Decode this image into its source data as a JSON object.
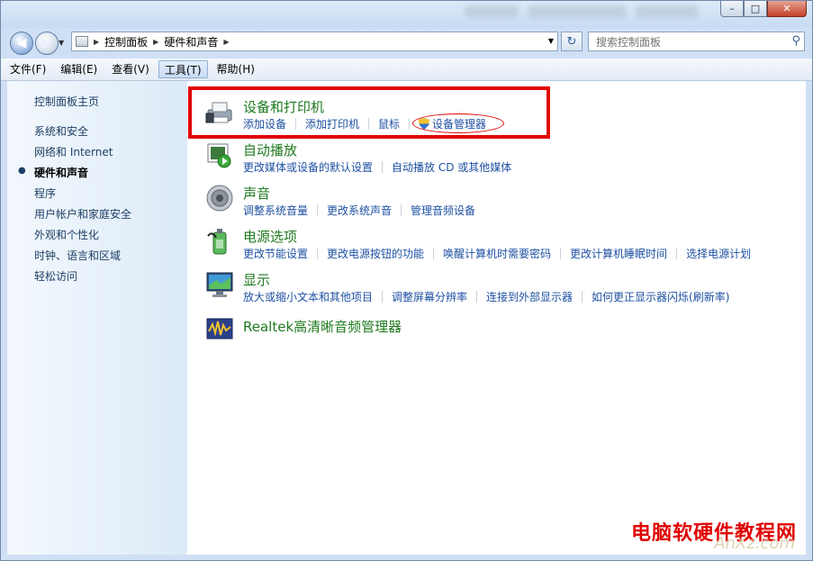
{
  "window": {
    "controls": {
      "minimize": "–",
      "maximize": "□",
      "close": "✕"
    }
  },
  "nav": {
    "back_icon": "back-arrow-icon",
    "forward_icon": "forward-arrow-icon",
    "breadcrumb": [
      "控制面板",
      "硬件和声音"
    ],
    "search_placeholder": "搜索控制面板"
  },
  "menu": {
    "items": [
      "文件(F)",
      "编辑(E)",
      "查看(V)",
      "工具(T)",
      "帮助(H)"
    ],
    "active_index": 3
  },
  "sidebar": {
    "home": "控制面板主页",
    "items": [
      "系统和安全",
      "网络和 Internet",
      "硬件和声音",
      "程序",
      "用户帐户和家庭安全",
      "外观和个性化",
      "时钟、语言和区域",
      "轻松访问"
    ],
    "current_index": 2
  },
  "categories": [
    {
      "title": "设备和打印机",
      "icon": "printer-icon",
      "links": [
        "添加设备",
        "添加打印机",
        "鼠标",
        "设备管理器"
      ]
    },
    {
      "title": "自动播放",
      "icon": "autoplay-icon",
      "links": [
        "更改媒体或设备的默认设置",
        "自动播放 CD 或其他媒体"
      ]
    },
    {
      "title": "声音",
      "icon": "speaker-icon",
      "links": [
        "调整系统音量",
        "更改系统声音",
        "管理音频设备"
      ]
    },
    {
      "title": "电源选项",
      "icon": "power-icon",
      "links": [
        "更改节能设置",
        "更改电源按钮的功能",
        "唤醒计算机时需要密码",
        "更改计算机睡眠时间",
        "选择电源计划"
      ]
    },
    {
      "title": "显示",
      "icon": "monitor-icon",
      "links": [
        "放大或缩小文本和其他项目",
        "调整屏幕分辨率",
        "连接到外部显示器",
        "如何更正显示器闪烁(刷新率)"
      ]
    },
    {
      "title": "Realtek高清晰音频管理器",
      "icon": "realtek-audio-icon",
      "links": []
    }
  ],
  "watermark": {
    "text": "电脑软硬件教程网",
    "sub": "AnXz.com"
  },
  "colors": {
    "highlight": "#e00000",
    "category_title": "#1f7a1f",
    "link": "#1e50a2"
  }
}
